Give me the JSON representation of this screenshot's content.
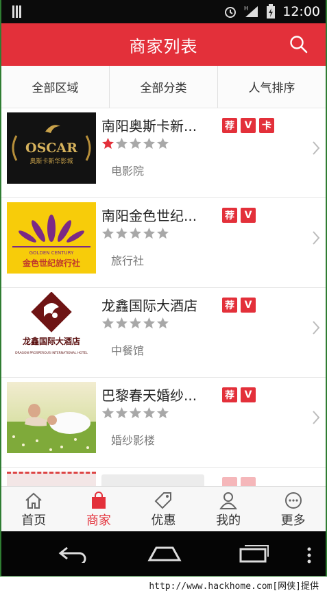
{
  "status": {
    "time": "12:00"
  },
  "header": {
    "title": "商家列表"
  },
  "filters": [
    "全部区域",
    "全部分类",
    "人气排序"
  ],
  "merchants": [
    {
      "name": "南阳奥斯卡新...",
      "tags": [
        "荐",
        "V",
        "卡"
      ],
      "rating": 1,
      "category": "电影院",
      "logo": {
        "main": "OSCAR",
        "sub": "奥斯卡新华影城"
      }
    },
    {
      "name": "南阳金色世纪...",
      "tags": [
        "荐",
        "V"
      ],
      "rating": 0,
      "category": "旅行社",
      "logo": {
        "main": "GOLDEN CENTURY",
        "sub": "金色世纪旅行社"
      }
    },
    {
      "name": "龙鑫国际大酒店",
      "tags": [
        "荐",
        "V"
      ],
      "rating": 0,
      "category": "中餐馆",
      "logo": {
        "main": "龙鑫国际大酒店",
        "sub": "DRAGON PROSPEROUS INTERNATIONAL HOTEL"
      }
    },
    {
      "name": "巴黎春天婚纱...",
      "tags": [
        "荐",
        "V"
      ],
      "rating": 0,
      "category": "婚纱影楼"
    }
  ],
  "tabbar": [
    {
      "label": "首页",
      "icon": "home-icon",
      "active": false
    },
    {
      "label": "商家",
      "icon": "bag-icon",
      "active": true
    },
    {
      "label": "优惠",
      "icon": "tag-icon",
      "active": false
    },
    {
      "label": "我的",
      "icon": "user-icon",
      "active": false
    },
    {
      "label": "更多",
      "icon": "more-icon",
      "active": false
    }
  ],
  "watermark": "http://www.hackhome.com[网侠]提供",
  "colors": {
    "accent": "#e3303a",
    "star_on": "#e3303a",
    "star_off": "#a8a8a8"
  }
}
